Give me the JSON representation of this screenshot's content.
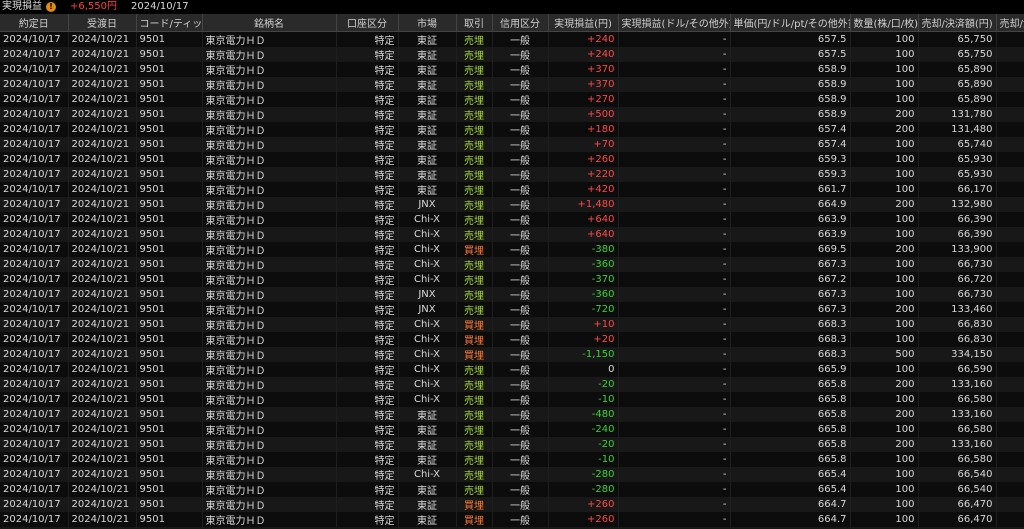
{
  "header": {
    "title": "実現損益",
    "total_pl": "+6,550円",
    "date": "2024/10/17"
  },
  "columns": [
    "約定日",
    "受渡日",
    "コード/ティッカー",
    "銘柄名",
    "口座区分",
    "市場",
    "取引",
    "信用区分",
    "実現損益(円)",
    "実現損益(ドル/その他外貨)",
    "単価(円/ドル/pt/その他外貨)",
    "数量(株/口/枚)",
    "売却/決済額(円)",
    "売却/決済"
  ],
  "common": {
    "trade_date": "2024/10/17",
    "settle_date": "2024/10/21",
    "code": "9501",
    "name": "東京電力ＨＤ",
    "account": "特定",
    "margin": "一般",
    "fx_pl": "-"
  },
  "rows": [
    {
      "market": "東証",
      "side": "売埋",
      "pl": "+240",
      "price": "657.5",
      "qty": "100",
      "amount": "65,750"
    },
    {
      "market": "東証",
      "side": "売埋",
      "pl": "+240",
      "price": "657.5",
      "qty": "100",
      "amount": "65,750"
    },
    {
      "market": "東証",
      "side": "売埋",
      "pl": "+370",
      "price": "658.9",
      "qty": "100",
      "amount": "65,890"
    },
    {
      "market": "東証",
      "side": "売埋",
      "pl": "+370",
      "price": "658.9",
      "qty": "100",
      "amount": "65,890"
    },
    {
      "market": "東証",
      "side": "売埋",
      "pl": "+270",
      "price": "658.9",
      "qty": "100",
      "amount": "65,890"
    },
    {
      "market": "東証",
      "side": "売埋",
      "pl": "+500",
      "price": "658.9",
      "qty": "200",
      "amount": "131,780"
    },
    {
      "market": "東証",
      "side": "売埋",
      "pl": "+180",
      "price": "657.4",
      "qty": "200",
      "amount": "131,480"
    },
    {
      "market": "東証",
      "side": "売埋",
      "pl": "+70",
      "price": "657.4",
      "qty": "100",
      "amount": "65,740"
    },
    {
      "market": "東証",
      "side": "売埋",
      "pl": "+260",
      "price": "659.3",
      "qty": "100",
      "amount": "65,930"
    },
    {
      "market": "東証",
      "side": "売埋",
      "pl": "+220",
      "price": "659.3",
      "qty": "100",
      "amount": "65,930"
    },
    {
      "market": "東証",
      "side": "売埋",
      "pl": "+420",
      "price": "661.7",
      "qty": "100",
      "amount": "66,170"
    },
    {
      "market": "JNX",
      "side": "売埋",
      "pl": "+1,480",
      "price": "664.9",
      "qty": "200",
      "amount": "132,980"
    },
    {
      "market": "Chi-X",
      "side": "売埋",
      "pl": "+640",
      "price": "663.9",
      "qty": "100",
      "amount": "66,390"
    },
    {
      "market": "Chi-X",
      "side": "売埋",
      "pl": "+640",
      "price": "663.9",
      "qty": "100",
      "amount": "66,390"
    },
    {
      "market": "Chi-X",
      "side": "買埋",
      "pl": "-380",
      "price": "669.5",
      "qty": "200",
      "amount": "133,900"
    },
    {
      "market": "Chi-X",
      "side": "売埋",
      "pl": "-360",
      "price": "667.3",
      "qty": "100",
      "amount": "66,730"
    },
    {
      "market": "Chi-X",
      "side": "売埋",
      "pl": "-370",
      "price": "667.2",
      "qty": "100",
      "amount": "66,720"
    },
    {
      "market": "JNX",
      "side": "売埋",
      "pl": "-360",
      "price": "667.3",
      "qty": "100",
      "amount": "66,730"
    },
    {
      "market": "JNX",
      "side": "売埋",
      "pl": "-720",
      "price": "667.3",
      "qty": "200",
      "amount": "133,460"
    },
    {
      "market": "Chi-X",
      "side": "買埋",
      "pl": "+10",
      "price": "668.3",
      "qty": "100",
      "amount": "66,830"
    },
    {
      "market": "Chi-X",
      "side": "買埋",
      "pl": "+20",
      "price": "668.3",
      "qty": "100",
      "amount": "66,830"
    },
    {
      "market": "Chi-X",
      "side": "買埋",
      "pl": "-1,150",
      "price": "668.3",
      "qty": "500",
      "amount": "334,150"
    },
    {
      "market": "Chi-X",
      "side": "売埋",
      "pl": "0",
      "price": "665.9",
      "qty": "100",
      "amount": "66,590"
    },
    {
      "market": "Chi-X",
      "side": "売埋",
      "pl": "-20",
      "price": "665.8",
      "qty": "200",
      "amount": "133,160"
    },
    {
      "market": "Chi-X",
      "side": "売埋",
      "pl": "-10",
      "price": "665.8",
      "qty": "100",
      "amount": "66,580"
    },
    {
      "market": "東証",
      "side": "売埋",
      "pl": "-480",
      "price": "665.8",
      "qty": "200",
      "amount": "133,160"
    },
    {
      "market": "東証",
      "side": "売埋",
      "pl": "-240",
      "price": "665.8",
      "qty": "100",
      "amount": "66,580"
    },
    {
      "market": "東証",
      "side": "売埋",
      "pl": "-20",
      "price": "665.8",
      "qty": "200",
      "amount": "133,160"
    },
    {
      "market": "東証",
      "side": "売埋",
      "pl": "-10",
      "price": "665.8",
      "qty": "100",
      "amount": "66,580"
    },
    {
      "market": "Chi-X",
      "side": "売埋",
      "pl": "-280",
      "price": "665.4",
      "qty": "100",
      "amount": "66,540"
    },
    {
      "market": "東証",
      "side": "売埋",
      "pl": "-280",
      "price": "665.4",
      "qty": "100",
      "amount": "66,540"
    },
    {
      "market": "東証",
      "side": "買埋",
      "pl": "+260",
      "price": "664.7",
      "qty": "100",
      "amount": "66,470"
    },
    {
      "market": "東証",
      "side": "買埋",
      "pl": "+260",
      "price": "664.7",
      "qty": "100",
      "amount": "66,470"
    },
    {
      "market": "Chi-X",
      "side": "売埋",
      "pl": "+50",
      "price": "665.3",
      "qty": "100",
      "amount": "66,530"
    }
  ],
  "colors": {
    "positive": "#ff4646",
    "negative": "#39d232",
    "sell": "#a4d63a",
    "buy": "#ff7a30",
    "header_bg": "#2a2a2a"
  }
}
